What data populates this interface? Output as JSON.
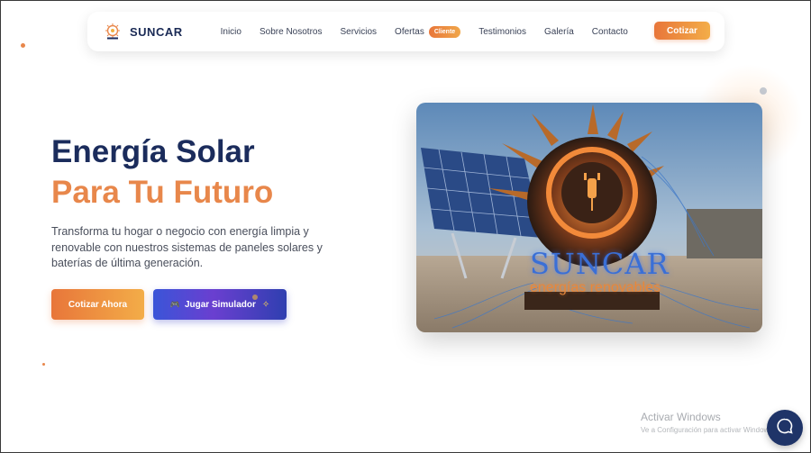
{
  "nav": {
    "brand": "SUNCAR",
    "links": [
      {
        "label": "Inicio"
      },
      {
        "label": "Sobre Nosotros"
      },
      {
        "label": "Servicios"
      },
      {
        "label": "Ofertas",
        "badge": "Cliente"
      },
      {
        "label": "Testimonios"
      },
      {
        "label": "Galería"
      },
      {
        "label": "Contacto"
      }
    ],
    "cta": "Cotizar"
  },
  "hero": {
    "title_line1": "Energía Solar",
    "title_line2": "Para Tu Futuro",
    "description": "Transforma tu hogar o negocio con energía limpia y renovable con nuestros sistemas de paneles solares y baterías de última generación.",
    "primary_button": "Cotizar Ahora",
    "secondary_button": "Jugar Simulador",
    "image": {
      "brand_text": "SUNCAR",
      "tagline": "energías renovables"
    }
  },
  "watermark": {
    "title": "Activar Windows",
    "subtitle": "Ve a Configuración para activar Windows."
  },
  "icons": {
    "logo": "suncar-sun-logo",
    "gamepad": "gamepad-icon",
    "sparkle": "sparkle-icon",
    "chat": "chat-bubble-icon"
  },
  "colors": {
    "navy": "#1b2c5c",
    "orange": "#e8874b",
    "purple_blue": "#3a55d8"
  }
}
